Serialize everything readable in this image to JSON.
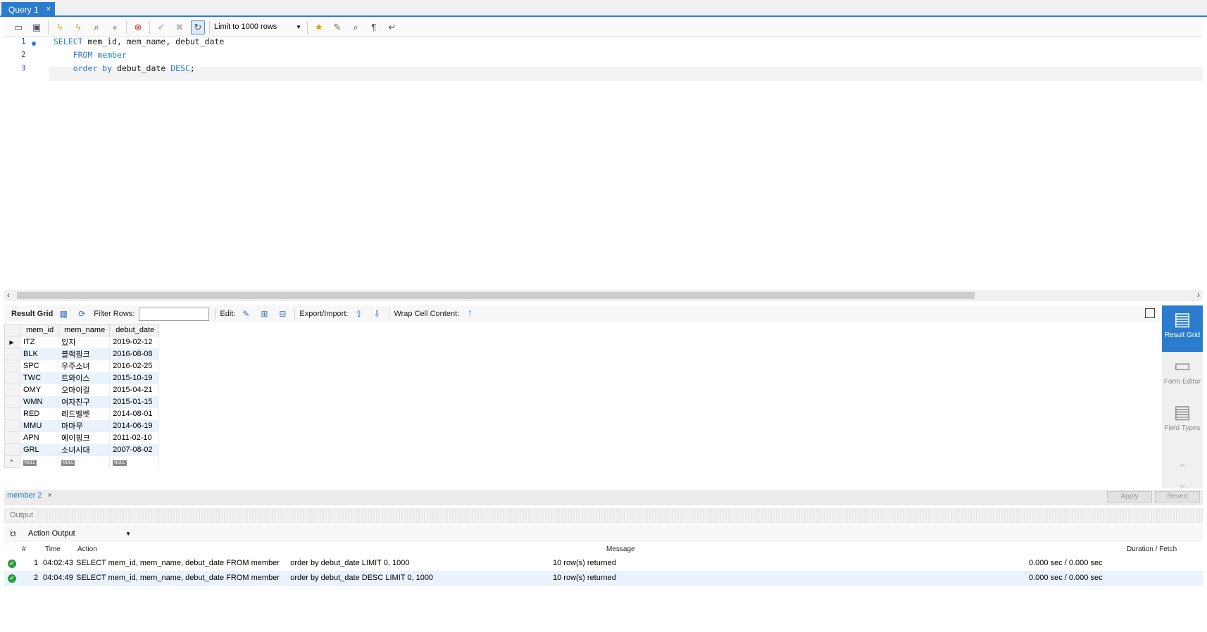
{
  "query_tab": {
    "label": "Query 1",
    "close": "×"
  },
  "toolbar": {
    "icons": [
      "open-file-icon",
      "save-icon",
      "execute-icon",
      "execute-current-icon",
      "explain-icon",
      "stop-icon",
      "toggle-error-icon",
      "commit-icon",
      "rollback-icon",
      "autocommit-icon",
      "bookmark-icon",
      "beautify-icon",
      "find-icon",
      "invisible-chars-icon",
      "wrap-icon"
    ],
    "limit_label": "Limit to 1000 rows"
  },
  "editor": {
    "lines": [
      {
        "n": "1",
        "parts": [
          [
            "kw",
            "SELECT"
          ],
          [
            "t",
            " mem_id, mem_name, debut_date"
          ]
        ]
      },
      {
        "n": "2",
        "parts": [
          [
            "t",
            "    "
          ],
          [
            "kw",
            "FROM"
          ],
          [
            "t",
            " "
          ],
          [
            "kw",
            "member"
          ]
        ]
      },
      {
        "n": "3",
        "parts": [
          [
            "t",
            "    "
          ],
          [
            "kw",
            "order by"
          ],
          [
            "t",
            " debut_date "
          ],
          [
            "kw",
            "DESC"
          ],
          [
            "t",
            ";"
          ]
        ]
      }
    ]
  },
  "result_toolbar": {
    "result_grid": "Result Grid",
    "filter_rows": "Filter Rows:",
    "edit": "Edit:",
    "export_import": "Export/Import:",
    "wrap_cell": "Wrap Cell Content:"
  },
  "grid": {
    "columns": [
      "mem_id",
      "mem_name",
      "debut_date"
    ],
    "rows": [
      [
        "ITZ",
        "있지",
        "2019-02-12"
      ],
      [
        "BLK",
        "블랙핑크",
        "2016-08-08"
      ],
      [
        "SPC",
        "우주소녀",
        "2016-02-25"
      ],
      [
        "TWC",
        "트와이스",
        "2015-10-19"
      ],
      [
        "OMY",
        "오마이걸",
        "2015-04-21"
      ],
      [
        "WMN",
        "여자친구",
        "2015-01-15"
      ],
      [
        "RED",
        "레드벨벳",
        "2014-08-01"
      ],
      [
        "MMU",
        "마마무",
        "2014-06-19"
      ],
      [
        "APN",
        "에이핑크",
        "2011-02-10"
      ],
      [
        "GRL",
        "소녀시대",
        "2007-08-02"
      ]
    ],
    "null_label": "NULL",
    "new_row_marker": "*"
  },
  "side_panel": [
    {
      "label": "Result Grid",
      "icon": "result-grid-icon",
      "active": true
    },
    {
      "label": "Form Editor",
      "icon": "form-editor-icon",
      "active": false
    },
    {
      "label": "Field Types",
      "icon": "field-types-icon",
      "active": false
    }
  ],
  "result_tab": {
    "label": "member 2",
    "close": "×"
  },
  "buttons": {
    "apply": "Apply",
    "revert": "Revert"
  },
  "output": {
    "title": "Output",
    "selector": "Action Output",
    "headers": {
      "num": "#",
      "time": "Time",
      "action": "Action",
      "message": "Message",
      "duration": "Duration / Fetch"
    },
    "rows": [
      {
        "num": "1",
        "time": "04:02:43",
        "action": "SELECT mem_id, mem_name, debut_date FROM member     order by debut_date LIMIT 0, 1000",
        "message": "10 row(s) returned",
        "duration": "0.000 sec / 0.000 sec"
      },
      {
        "num": "2",
        "time": "04:04:49",
        "action": "SELECT mem_id, mem_name, debut_date FROM member     order by debut_date DESC LIMIT 0, 1000",
        "message": "10 row(s) returned",
        "duration": "0.000 sec / 0.000 sec"
      }
    ]
  },
  "colors": {
    "accent": "#2b7ccf",
    "keyword": "#2b7ccf",
    "ok": "#2e9e3e",
    "alt_row": "#eaf2fb"
  }
}
